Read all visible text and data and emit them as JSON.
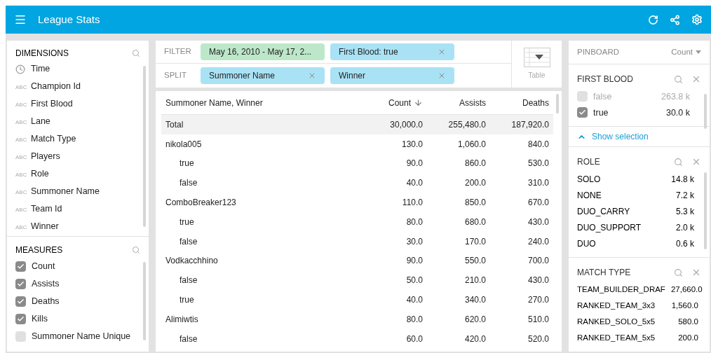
{
  "app_bar": {
    "title": "League Stats"
  },
  "dimensions": {
    "title": "DIMENSIONS",
    "items": [
      {
        "kind": "time",
        "label": "Time"
      },
      {
        "kind": "string",
        "label": "Champion Id",
        "icon_text": "ABC"
      },
      {
        "kind": "string",
        "label": "First Blood",
        "icon_text": "ABC"
      },
      {
        "kind": "string",
        "label": "Lane",
        "icon_text": "ABC"
      },
      {
        "kind": "string",
        "label": "Match Type",
        "icon_text": "ABC"
      },
      {
        "kind": "string",
        "label": "Players",
        "icon_text": "ABC"
      },
      {
        "kind": "string",
        "label": "Role",
        "icon_text": "ABC"
      },
      {
        "kind": "string",
        "label": "Summoner Name",
        "icon_text": "ABC"
      },
      {
        "kind": "string",
        "label": "Team Id",
        "icon_text": "ABC"
      },
      {
        "kind": "string",
        "label": "Winner",
        "icon_text": "ABC"
      }
    ]
  },
  "measures": {
    "title": "MEASURES",
    "items": [
      {
        "label": "Count",
        "checked": true
      },
      {
        "label": "Assists",
        "checked": true
      },
      {
        "label": "Deaths",
        "checked": true
      },
      {
        "label": "Kills",
        "checked": true
      },
      {
        "label": "Summoner Name Unique",
        "checked": false
      }
    ]
  },
  "filter": {
    "label": "FILTER",
    "pills": [
      {
        "kind": "time",
        "text": "May 16, 2010 - May 17, 2..."
      },
      {
        "kind": "dimension",
        "text": "First Blood: true"
      }
    ]
  },
  "split": {
    "label": "SPLIT",
    "pills": [
      {
        "kind": "dimension",
        "text": "Summoner Name"
      },
      {
        "kind": "dimension",
        "text": "Winner"
      }
    ]
  },
  "visualization": {
    "label": "Table"
  },
  "table": {
    "columns": [
      {
        "label": "Summoner Name, Winner",
        "sorted": false
      },
      {
        "label": "Count",
        "sorted": true
      },
      {
        "label": "Assists",
        "sorted": false
      },
      {
        "label": "Deaths",
        "sorted": false
      }
    ],
    "total": {
      "label": "Total",
      "values": [
        "30,000.0",
        "255,480.0",
        "187,920.0"
      ]
    },
    "rows": [
      {
        "label": "nikola005",
        "values": [
          "130.0",
          "1,060.0",
          "840.0"
        ],
        "children": [
          {
            "label": "true",
            "values": [
              "90.0",
              "860.0",
              "530.0"
            ]
          },
          {
            "label": "false",
            "values": [
              "40.0",
              "200.0",
              "310.0"
            ]
          }
        ]
      },
      {
        "label": "ComboBreaker123",
        "values": [
          "110.0",
          "850.0",
          "670.0"
        ],
        "children": [
          {
            "label": "true",
            "values": [
              "80.0",
              "680.0",
              "430.0"
            ]
          },
          {
            "label": "false",
            "values": [
              "30.0",
              "170.0",
              "240.0"
            ]
          }
        ]
      },
      {
        "label": "Vodkacchhino",
        "values": [
          "90.0",
          "550.0",
          "700.0"
        ],
        "children": [
          {
            "label": "false",
            "values": [
              "50.0",
              "210.0",
              "430.0"
            ]
          },
          {
            "label": "true",
            "values": [
              "40.0",
              "340.0",
              "270.0"
            ]
          }
        ]
      },
      {
        "label": "Alimiwtis",
        "values": [
          "80.0",
          "620.0",
          "510.0"
        ],
        "children": [
          {
            "label": "false",
            "values": [
              "60.0",
              "420.0",
              "520.0"
            ]
          }
        ]
      }
    ]
  },
  "pinboard": {
    "title": "PINBOARD",
    "measure": "Count",
    "first_blood": {
      "title": "FIRST BLOOD",
      "items": [
        {
          "label": "false",
          "value": "263.8 k",
          "checked": false
        },
        {
          "label": "true",
          "value": "30.0 k",
          "checked": true
        }
      ],
      "show_selection": "Show selection"
    },
    "role": {
      "title": "ROLE",
      "items": [
        {
          "label": "SOLO",
          "value": "14.8 k"
        },
        {
          "label": "NONE",
          "value": "7.2 k"
        },
        {
          "label": "DUO_CARRY",
          "value": "5.3 k"
        },
        {
          "label": "DUO_SUPPORT",
          "value": "2.0 k"
        },
        {
          "label": "DUO",
          "value": "0.6 k"
        }
      ]
    },
    "match_type": {
      "title": "MATCH TYPE",
      "items": [
        {
          "label": "TEAM_BUILDER_DRAF",
          "value": "27,660.0"
        },
        {
          "label": "RANKED_TEAM_3x3",
          "value": "1,560.0"
        },
        {
          "label": "RANKED_SOLO_5x5",
          "value": "580.0"
        },
        {
          "label": "RANKED_TEAM_5x5",
          "value": "200.0"
        }
      ]
    }
  }
}
